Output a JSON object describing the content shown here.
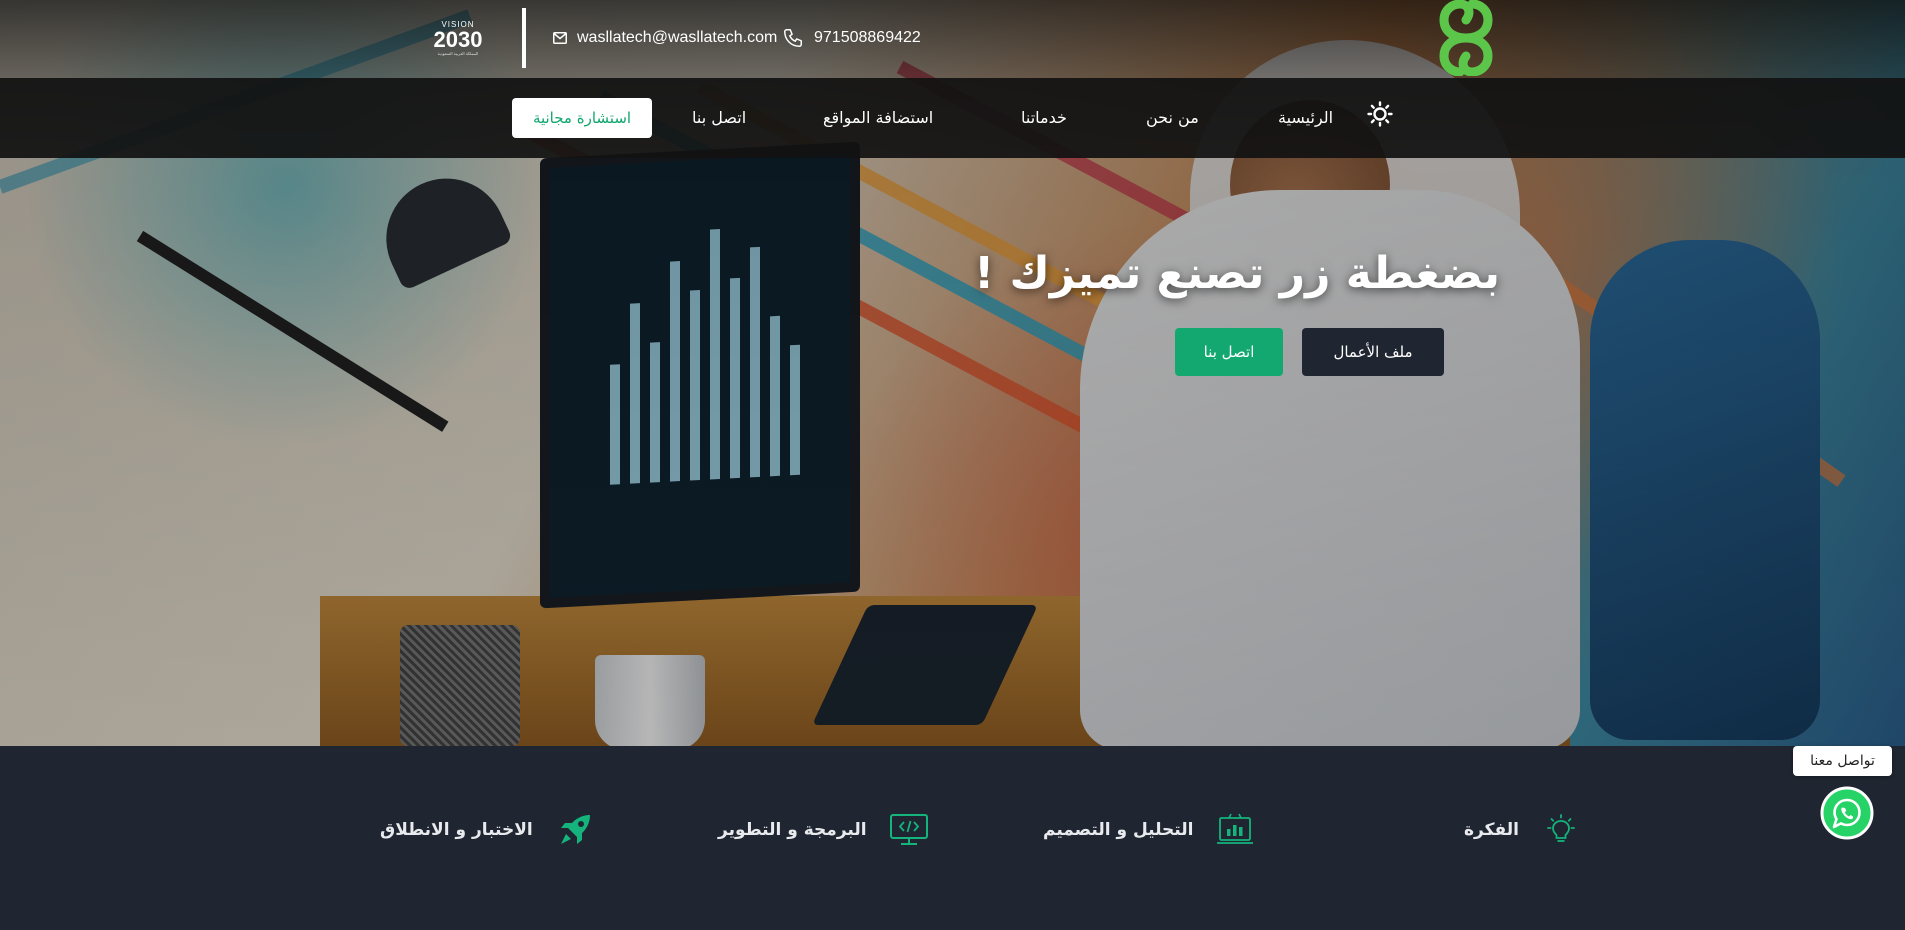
{
  "header": {
    "vision_logo": {
      "top_text": "VISION",
      "arabic_text": "رؤيـة",
      "number_text": "2030",
      "sub_text": "المملكة العربية السعودية"
    },
    "email": "wasllatech@wasllatech.com",
    "phone": "971508869422",
    "brand_color": "#5cc64a"
  },
  "nav": {
    "items": [
      {
        "label": "الرئيسية"
      },
      {
        "label": "من نحن"
      },
      {
        "label": "خدماتنا"
      },
      {
        "label": "استضافة المواقع"
      },
      {
        "label": "اتصل بنا"
      }
    ],
    "cta_label": "استشارة مجانية",
    "theme_icon": "sun-icon"
  },
  "hero": {
    "title": "بضغطة زر تصنع تميزك !",
    "portfolio_button": "ملف الأعمال",
    "contact_button": "اتصل بنا",
    "accent_color": "#12a870"
  },
  "steps": [
    {
      "label": "الفكرة",
      "icon": "lightbulb-icon"
    },
    {
      "label": "التحليل و التصميم",
      "icon": "analysis-icon"
    },
    {
      "label": "البرمجة و التطوير",
      "icon": "code-monitor-icon"
    },
    {
      "label": "الاختبار و الانطلاق",
      "icon": "rocket-icon"
    }
  ],
  "whatsapp": {
    "label": "تواصل معنا",
    "icon": "whatsapp-icon",
    "color": "#25d366"
  }
}
